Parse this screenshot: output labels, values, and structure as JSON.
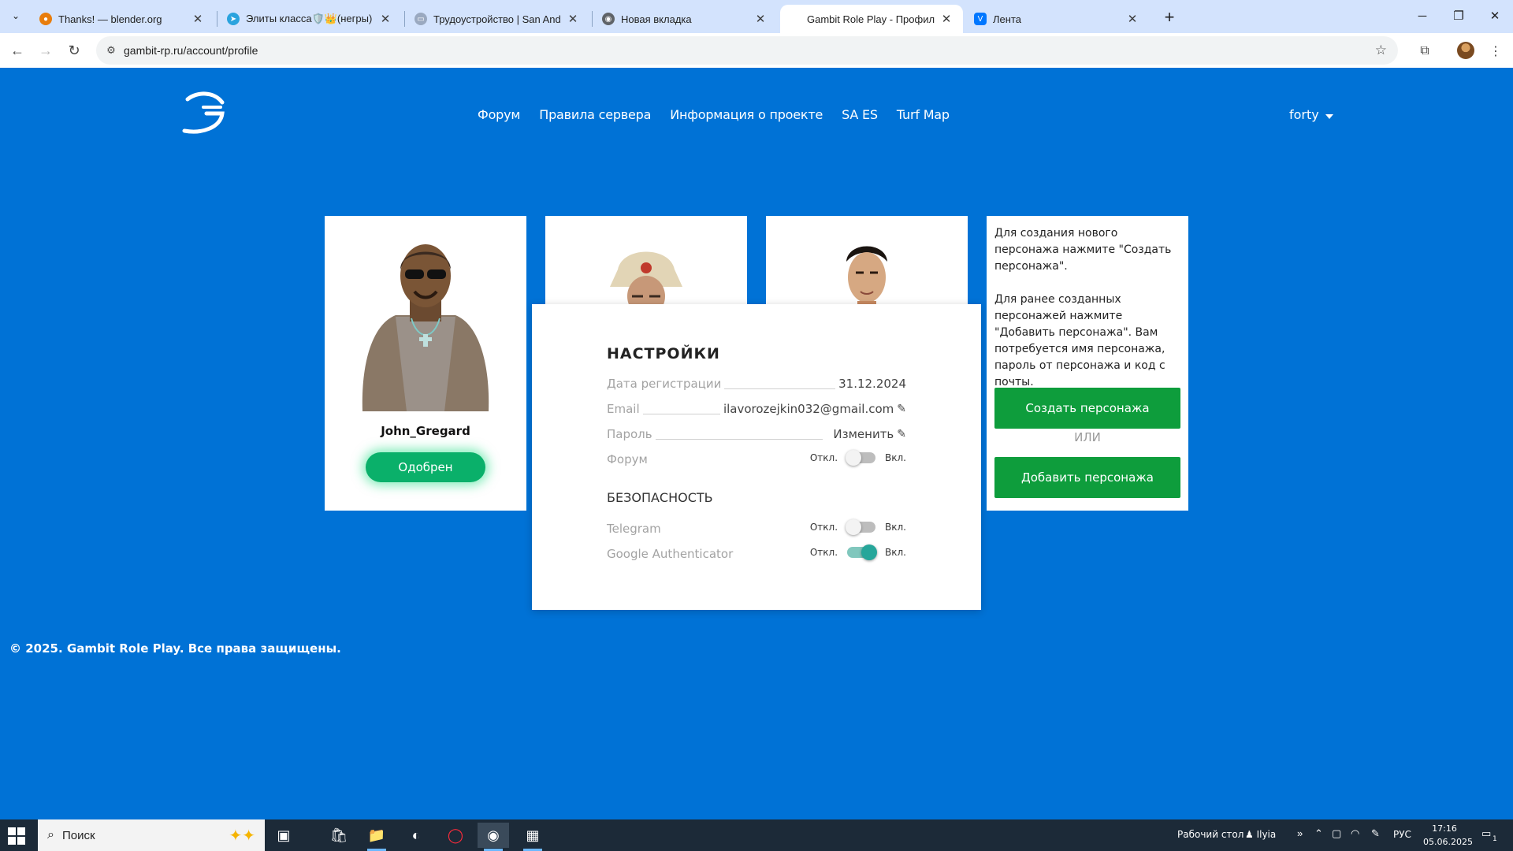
{
  "browser": {
    "tabs": [
      {
        "title": "Thanks! — blender.org",
        "active": false
      },
      {
        "title": "Элиты класса🛡️👑(негры)",
        "active": false
      },
      {
        "title": "Трудоустройство | San Andreas",
        "active": false
      },
      {
        "title": "Новая вкладка",
        "active": false
      },
      {
        "title": "Gambit Role Play - Профиль UCP",
        "active": true
      },
      {
        "title": "Лента",
        "active": false
      }
    ],
    "url": "gambit-rp.ru/account/profile"
  },
  "site": {
    "nav": [
      "Форум",
      "Правила сервера",
      "Информация о проекте",
      "SA ES",
      "Turf Map"
    ],
    "user": "forty",
    "characters": [
      {
        "name": "John_Gregard",
        "status": "Одобрен"
      }
    ],
    "info": {
      "text1": "Для создания нового персонажа нажмите \"Создать персонажа\".",
      "text2": "Для ранее созданных персонажей нажмите \"Добавить персонажа\". Вам потребуется имя персонажа, пароль от персонажа и код с почты.",
      "create_button": "Создать персонажа",
      "or": "ИЛИ",
      "add_button": "Добавить персонажа"
    },
    "settings": {
      "title": "НАСТРОЙКИ",
      "reg_label": "Дата регистрации",
      "reg_value": "31.12.2024",
      "email_label": "Email",
      "email_value": "ilavorozejkin032@gmail.com",
      "password_label": "Пароль",
      "password_value": "Изменить",
      "forum_label": "Форум",
      "off": "Откл.",
      "on": "Вкл.",
      "security_title": "БЕЗОПАСНОСТЬ",
      "telegram_label": "Telegram",
      "ga_label": "Google Authenticator",
      "forum_enabled": false,
      "telegram_enabled": false,
      "ga_enabled": true
    },
    "footer": "© 2025. Gambit Role Play. Все права защищены."
  },
  "taskbar": {
    "search_placeholder": "Поиск",
    "desktop_label": "Рабочий стол",
    "user": "Ilyia",
    "lang": "РУС",
    "time": "17:16",
    "date": "05.06.2025",
    "notif_count": "1"
  },
  "colors": {
    "page_bg": "#0072d6",
    "green": "#0e9d3c",
    "approved": "#0ab06a",
    "toggle_on": "#26a69a"
  }
}
